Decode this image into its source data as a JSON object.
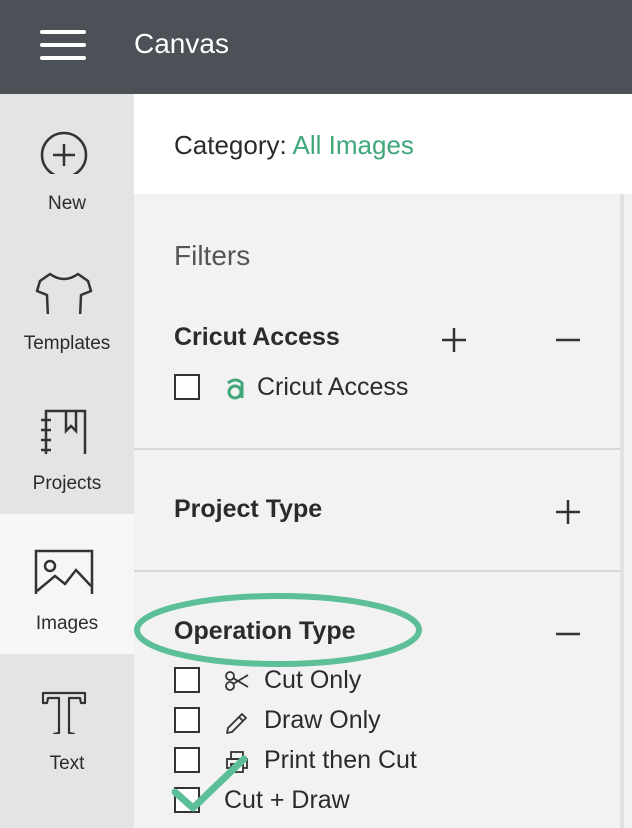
{
  "header": {
    "app_title": "Canvas",
    "menu_icon": "hamburger-icon"
  },
  "sidebar": {
    "items": [
      {
        "label": "New",
        "icon": "plus-circle-icon",
        "active": false
      },
      {
        "label": "Templates",
        "icon": "tshirt-icon",
        "active": false
      },
      {
        "label": "Projects",
        "icon": "notebook-icon",
        "active": false
      },
      {
        "label": "Images",
        "icon": "image-icon",
        "active": true
      },
      {
        "label": "Text",
        "icon": "text-icon",
        "active": false
      }
    ]
  },
  "category": {
    "label": "Category:",
    "value": "All Images"
  },
  "filters": {
    "title": "Filters",
    "sections": [
      {
        "title": "Cricut Access",
        "options": [
          {
            "label": "Cricut Access",
            "checked": false,
            "icon": "cricut-access-icon"
          }
        ]
      },
      {
        "title": "Project Type",
        "options": []
      },
      {
        "title": "Operation Type",
        "options": [
          {
            "label": "Cut Only",
            "checked": false,
            "icon": "scissors-icon"
          },
          {
            "label": "Draw Only",
            "checked": false,
            "icon": "pencil-icon"
          },
          {
            "label": "Print then Cut",
            "checked": false,
            "icon": "printer-icon"
          },
          {
            "label": "Cut + Draw",
            "checked": true,
            "icon": ""
          }
        ]
      }
    ]
  },
  "colors": {
    "accent": "#3fa77a",
    "header_bg": "#4b5157",
    "highlight": "#5cbf97"
  }
}
